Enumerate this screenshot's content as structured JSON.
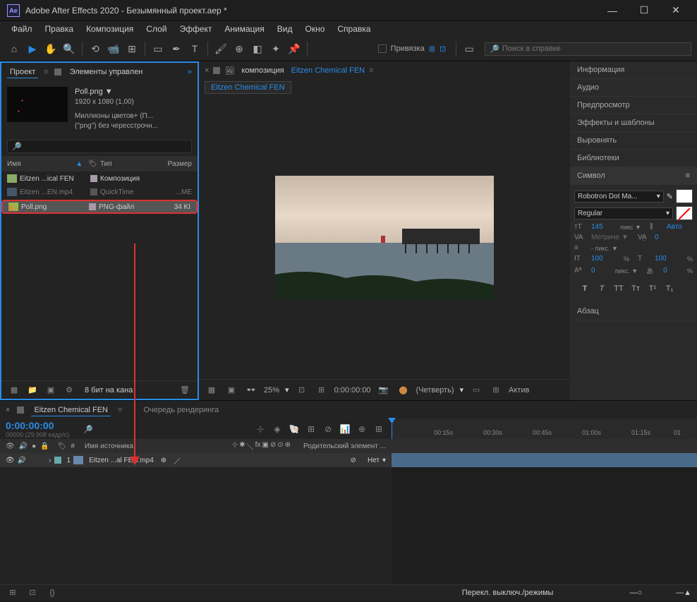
{
  "app": {
    "title": "Adobe After Effects 2020 - Безымянный проект.aep *",
    "logo": "Ae"
  },
  "menu": [
    "Файл",
    "Правка",
    "Композиция",
    "Слой",
    "Эффект",
    "Анимация",
    "Вид",
    "Окно",
    "Справка"
  ],
  "toolbar": {
    "snap_label": "Привязка",
    "search_placeholder": "Поиск в справке"
  },
  "project_panel": {
    "tab_project": "Проект",
    "tab_controls": "Элементы управлен",
    "selected_name": "Poll.png ▼",
    "selected_dims": "1920 x 1080 (1,00)",
    "selected_info1": "Миллионы цветов+ (П...",
    "selected_info2": "(\"png\") без чересстрочн...",
    "cols": {
      "name": "Имя",
      "type": "Тип",
      "size": "Размер"
    },
    "items": [
      {
        "name": "Eitzen ...ical FEN",
        "type": "Композиция",
        "size": "",
        "kind": "comp",
        "color": "#a9a"
      },
      {
        "name": "Eitzen ...EN.mp4",
        "type": "QuickTime",
        "size": "...ME",
        "kind": "mov",
        "color": "#888"
      },
      {
        "name": "Poll.png",
        "type": "PNG-файл",
        "size": "34 KI",
        "kind": "png",
        "color": "#a9a"
      }
    ],
    "footer_bpc": "8 бит на кана"
  },
  "composition": {
    "tab_label": "композиция",
    "comp_name": "Eitzen Chemical FEN",
    "subtab": "Eitzen Chemical FEN",
    "zoom": "25%",
    "timecode": "0:00:00:00",
    "quality": "(Четверть)",
    "active": "Актив"
  },
  "right_panel": {
    "sections": [
      "Информация",
      "Аудио",
      "Предпросмотр",
      "Эффекты и шаблоны",
      "Выровнять",
      "Библиотеки"
    ],
    "character": {
      "title": "Символ",
      "font": "Robotron Dot Ma...",
      "style": "Regular",
      "size_val": "145",
      "size_unit": "пикс ▼",
      "leading": "Авто",
      "kerning": "Метриче ▼",
      "tracking": "0",
      "stroke_unit": "- пикс. ▼",
      "vscale": "100",
      "hscale": "100",
      "baseline": "0",
      "tsume": "0",
      "pct": "%",
      "px": "пикс. ▼"
    },
    "paragraph": "Абзац"
  },
  "timeline": {
    "tab_comp": "Eitzen Chemical FEN",
    "tab_render": "Очередь рендеринга",
    "timecode": "0:00:00:00",
    "frames": "00000 (29,908 кадр/с)",
    "col_source": "Имя источника",
    "col_parent": "Родительский элемент ...",
    "parent_value": "Нет",
    "layers": [
      {
        "num": "1",
        "name": "Eitzen ...al FEN.mp4"
      }
    ],
    "ticks": [
      "00:15s",
      "00:30s",
      "00:45s",
      "01:00s",
      "01:15s",
      "01"
    ],
    "footer": "Перекл. выключ./режимы"
  }
}
